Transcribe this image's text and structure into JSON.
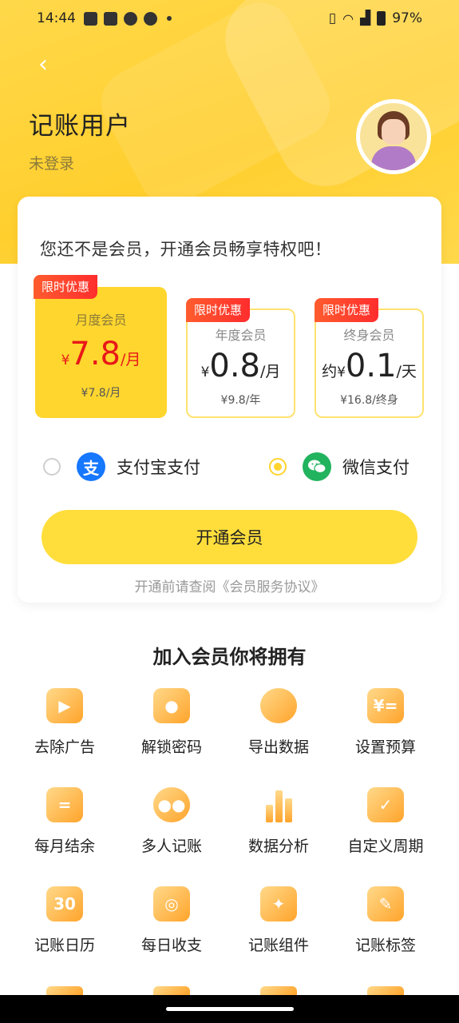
{
  "status_bar": {
    "time": "14:44",
    "battery": "97%"
  },
  "header": {
    "user_name": "记账用户",
    "login_status": "未登录"
  },
  "membership": {
    "prompt": "您还不是会员，开通会员畅享特权吧！",
    "plans": [
      {
        "badge": "限时优惠",
        "name": "月度会员",
        "prefix": "",
        "currency": "¥",
        "price": "7.8",
        "unit": "/月",
        "original": "¥7.8/月",
        "selected": true
      },
      {
        "badge": "限时优惠",
        "name": "年度会员",
        "prefix": "",
        "currency": "¥",
        "price": "0.8",
        "unit": "/月",
        "original": "¥9.8/年",
        "selected": false
      },
      {
        "badge": "限时优惠",
        "name": "终身会员",
        "prefix": "约",
        "currency": "¥",
        "price": "0.1",
        "unit": "/天",
        "original": "¥16.8/终身",
        "selected": false
      }
    ],
    "payment": {
      "alipay_label": "支付宝支付",
      "alipay_icon_text": "支",
      "wechat_label": "微信支付",
      "selected": "wechat"
    },
    "open_button": "开通会员",
    "agreement": "开通前请查阅《会员服务协议》"
  },
  "benefits": {
    "title": "加入会员你将拥有",
    "items": [
      {
        "label": "去除广告",
        "icon": "ad-block-icon",
        "glyph": "▶"
      },
      {
        "label": "解锁密码",
        "icon": "lock-icon",
        "glyph": "●"
      },
      {
        "label": "导出数据",
        "icon": "pie-chart-icon",
        "glyph": ""
      },
      {
        "label": "设置预算",
        "icon": "budget-icon",
        "glyph": "¥="
      },
      {
        "label": "每月结余",
        "icon": "receipt-icon",
        "glyph": "="
      },
      {
        "label": "多人记账",
        "icon": "users-icon",
        "glyph": "●●"
      },
      {
        "label": "数据分析",
        "icon": "bar-chart-icon",
        "glyph": ""
      },
      {
        "label": "自定义周期",
        "icon": "custom-cycle-icon",
        "glyph": "✓"
      },
      {
        "label": "记账日历",
        "icon": "calendar-icon",
        "glyph": "30"
      },
      {
        "label": "每日收支",
        "icon": "daily-icon",
        "glyph": "◎"
      },
      {
        "label": "记账组件",
        "icon": "widget-icon",
        "glyph": "✦"
      },
      {
        "label": "记账标签",
        "icon": "tag-icon",
        "glyph": "✎"
      }
    ]
  }
}
